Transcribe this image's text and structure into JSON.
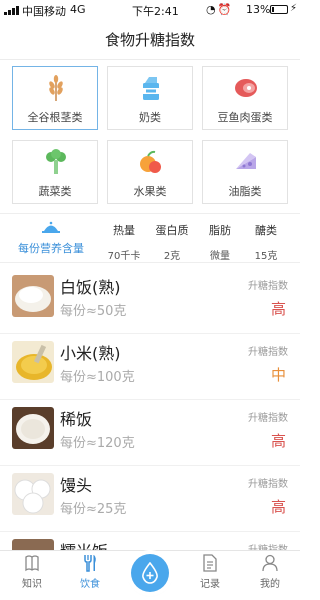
{
  "status_bar": {
    "carrier": "中国移动",
    "network": "4G",
    "time": "下午2:41",
    "battery": "13%",
    "battery_level": 0.13
  },
  "header": {
    "title": "食物升糖指数"
  },
  "categories": [
    {
      "label": "全谷根茎类",
      "icon": "wheat-icon",
      "selected": true
    },
    {
      "label": "奶类",
      "icon": "milk-carton-icon",
      "selected": false
    },
    {
      "label": "豆鱼肉蛋类",
      "icon": "meat-icon",
      "selected": false
    },
    {
      "label": "蔬菜类",
      "icon": "broccoli-icon",
      "selected": false
    },
    {
      "label": "水果类",
      "icon": "fruit-icon",
      "selected": false
    },
    {
      "label": "油脂类",
      "icon": "cheese-icon",
      "selected": false
    }
  ],
  "nutrients": {
    "per_serving_label": "每份营养含量",
    "columns": [
      {
        "name": "热量",
        "value": "70千卡"
      },
      {
        "name": "蛋白质",
        "value": "2克"
      },
      {
        "name": "脂肪",
        "value": "微量"
      },
      {
        "name": "醣类",
        "value": "15克"
      }
    ]
  },
  "foods": [
    {
      "name": "白饭(熟)",
      "portion": "每份≈50克",
      "gi_label": "升糖指数",
      "gi": "高"
    },
    {
      "name": "小米(熟)",
      "portion": "每份≈100克",
      "gi_label": "升糖指数",
      "gi": "中"
    },
    {
      "name": "稀饭",
      "portion": "每份≈120克",
      "gi_label": "升糖指数",
      "gi": "高"
    },
    {
      "name": "馒头",
      "portion": "每份≈25克",
      "gi_label": "升糖指数",
      "gi": "高"
    },
    {
      "name": "糯米饭",
      "portion": "",
      "gi_label": "升糖指数",
      "gi": ""
    }
  ],
  "tabbar": {
    "items": [
      {
        "label": "知识",
        "icon": "book-icon"
      },
      {
        "label": "饮食",
        "icon": "utensils-icon"
      },
      {
        "label": "记录",
        "icon": "document-icon"
      },
      {
        "label": "我的",
        "icon": "user-icon"
      }
    ],
    "center_icon": "add-drop-icon"
  },
  "colors": {
    "accent": "#3a8fd9",
    "gi_high": "#d9534f",
    "gi_medium": "#e88f3a",
    "selected_border": "#74b4e6"
  }
}
